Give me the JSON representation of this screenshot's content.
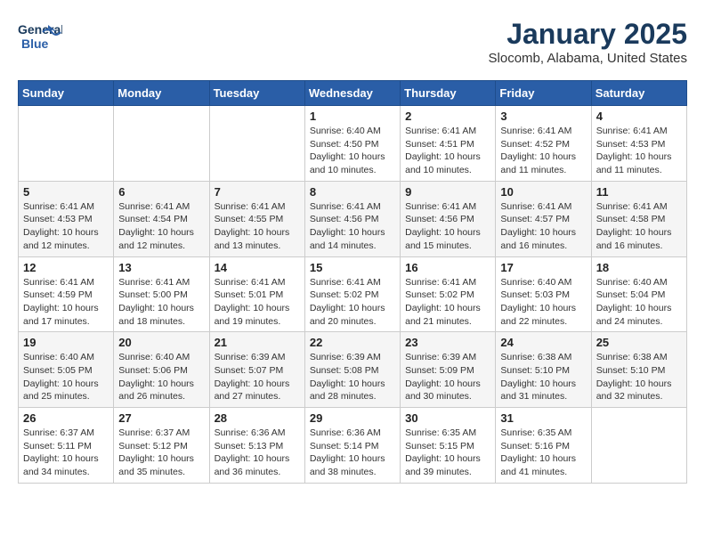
{
  "header": {
    "logo_line1": "General",
    "logo_line2": "Blue",
    "month": "January 2025",
    "location": "Slocomb, Alabama, United States"
  },
  "weekdays": [
    "Sunday",
    "Monday",
    "Tuesday",
    "Wednesday",
    "Thursday",
    "Friday",
    "Saturday"
  ],
  "weeks": [
    [
      {
        "day": "",
        "info": ""
      },
      {
        "day": "",
        "info": ""
      },
      {
        "day": "",
        "info": ""
      },
      {
        "day": "1",
        "info": "Sunrise: 6:40 AM\nSunset: 4:50 PM\nDaylight: 10 hours\nand 10 minutes."
      },
      {
        "day": "2",
        "info": "Sunrise: 6:41 AM\nSunset: 4:51 PM\nDaylight: 10 hours\nand 10 minutes."
      },
      {
        "day": "3",
        "info": "Sunrise: 6:41 AM\nSunset: 4:52 PM\nDaylight: 10 hours\nand 11 minutes."
      },
      {
        "day": "4",
        "info": "Sunrise: 6:41 AM\nSunset: 4:53 PM\nDaylight: 10 hours\nand 11 minutes."
      }
    ],
    [
      {
        "day": "5",
        "info": "Sunrise: 6:41 AM\nSunset: 4:53 PM\nDaylight: 10 hours\nand 12 minutes."
      },
      {
        "day": "6",
        "info": "Sunrise: 6:41 AM\nSunset: 4:54 PM\nDaylight: 10 hours\nand 12 minutes."
      },
      {
        "day": "7",
        "info": "Sunrise: 6:41 AM\nSunset: 4:55 PM\nDaylight: 10 hours\nand 13 minutes."
      },
      {
        "day": "8",
        "info": "Sunrise: 6:41 AM\nSunset: 4:56 PM\nDaylight: 10 hours\nand 14 minutes."
      },
      {
        "day": "9",
        "info": "Sunrise: 6:41 AM\nSunset: 4:56 PM\nDaylight: 10 hours\nand 15 minutes."
      },
      {
        "day": "10",
        "info": "Sunrise: 6:41 AM\nSunset: 4:57 PM\nDaylight: 10 hours\nand 16 minutes."
      },
      {
        "day": "11",
        "info": "Sunrise: 6:41 AM\nSunset: 4:58 PM\nDaylight: 10 hours\nand 16 minutes."
      }
    ],
    [
      {
        "day": "12",
        "info": "Sunrise: 6:41 AM\nSunset: 4:59 PM\nDaylight: 10 hours\nand 17 minutes."
      },
      {
        "day": "13",
        "info": "Sunrise: 6:41 AM\nSunset: 5:00 PM\nDaylight: 10 hours\nand 18 minutes."
      },
      {
        "day": "14",
        "info": "Sunrise: 6:41 AM\nSunset: 5:01 PM\nDaylight: 10 hours\nand 19 minutes."
      },
      {
        "day": "15",
        "info": "Sunrise: 6:41 AM\nSunset: 5:02 PM\nDaylight: 10 hours\nand 20 minutes."
      },
      {
        "day": "16",
        "info": "Sunrise: 6:41 AM\nSunset: 5:02 PM\nDaylight: 10 hours\nand 21 minutes."
      },
      {
        "day": "17",
        "info": "Sunrise: 6:40 AM\nSunset: 5:03 PM\nDaylight: 10 hours\nand 22 minutes."
      },
      {
        "day": "18",
        "info": "Sunrise: 6:40 AM\nSunset: 5:04 PM\nDaylight: 10 hours\nand 24 minutes."
      }
    ],
    [
      {
        "day": "19",
        "info": "Sunrise: 6:40 AM\nSunset: 5:05 PM\nDaylight: 10 hours\nand 25 minutes."
      },
      {
        "day": "20",
        "info": "Sunrise: 6:40 AM\nSunset: 5:06 PM\nDaylight: 10 hours\nand 26 minutes."
      },
      {
        "day": "21",
        "info": "Sunrise: 6:39 AM\nSunset: 5:07 PM\nDaylight: 10 hours\nand 27 minutes."
      },
      {
        "day": "22",
        "info": "Sunrise: 6:39 AM\nSunset: 5:08 PM\nDaylight: 10 hours\nand 28 minutes."
      },
      {
        "day": "23",
        "info": "Sunrise: 6:39 AM\nSunset: 5:09 PM\nDaylight: 10 hours\nand 30 minutes."
      },
      {
        "day": "24",
        "info": "Sunrise: 6:38 AM\nSunset: 5:10 PM\nDaylight: 10 hours\nand 31 minutes."
      },
      {
        "day": "25",
        "info": "Sunrise: 6:38 AM\nSunset: 5:10 PM\nDaylight: 10 hours\nand 32 minutes."
      }
    ],
    [
      {
        "day": "26",
        "info": "Sunrise: 6:37 AM\nSunset: 5:11 PM\nDaylight: 10 hours\nand 34 minutes."
      },
      {
        "day": "27",
        "info": "Sunrise: 6:37 AM\nSunset: 5:12 PM\nDaylight: 10 hours\nand 35 minutes."
      },
      {
        "day": "28",
        "info": "Sunrise: 6:36 AM\nSunset: 5:13 PM\nDaylight: 10 hours\nand 36 minutes."
      },
      {
        "day": "29",
        "info": "Sunrise: 6:36 AM\nSunset: 5:14 PM\nDaylight: 10 hours\nand 38 minutes."
      },
      {
        "day": "30",
        "info": "Sunrise: 6:35 AM\nSunset: 5:15 PM\nDaylight: 10 hours\nand 39 minutes."
      },
      {
        "day": "31",
        "info": "Sunrise: 6:35 AM\nSunset: 5:16 PM\nDaylight: 10 hours\nand 41 minutes."
      },
      {
        "day": "",
        "info": ""
      }
    ]
  ]
}
